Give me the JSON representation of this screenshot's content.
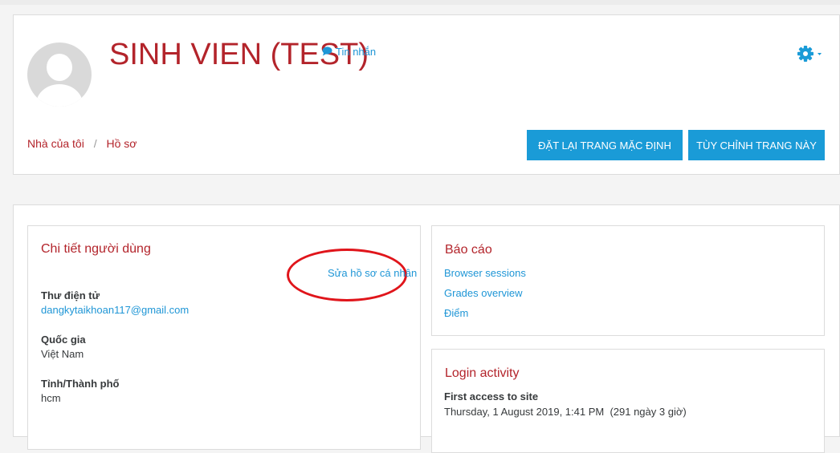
{
  "header": {
    "title": "SINH VIEN (TEST)",
    "message_link": "Tin nhắn",
    "breadcrumb": [
      "Nhà của tôi",
      "Hồ sơ"
    ],
    "buttons": {
      "reset": "ĐẶT LẠI TRANG MẶC ĐỊNH",
      "customize": "TÙY CHỈNH TRANG NÀY"
    }
  },
  "user_details": {
    "title": "Chi tiết người dùng",
    "edit_link": "Sửa hồ sơ cá nhân",
    "fields": [
      {
        "label": "Thư điện tử",
        "value": "dangkytaikhoan117@gmail.com"
      },
      {
        "label": "Quốc gia",
        "value": "Việt Nam"
      },
      {
        "label": "Tỉnh/Thành phố",
        "value": "hcm"
      }
    ]
  },
  "reports": {
    "title": "Báo cáo",
    "links": [
      "Browser sessions",
      "Grades overview",
      "Điểm"
    ]
  },
  "login_activity": {
    "title": "Login activity",
    "first_access_label": "First access to site",
    "first_access_value": "Thursday, 1 August 2019, 1:41 PM  (291 ngày 3 giờ)"
  },
  "icons": {
    "message": "speech-bubble-icon",
    "settings": "gear-icon",
    "avatar": "default-user-avatar"
  },
  "colors": {
    "brand_red": "#b3242b",
    "link_blue": "#1f96d6",
    "button_blue": "#1a9bd7",
    "highlight_oval": "#e0151b"
  }
}
